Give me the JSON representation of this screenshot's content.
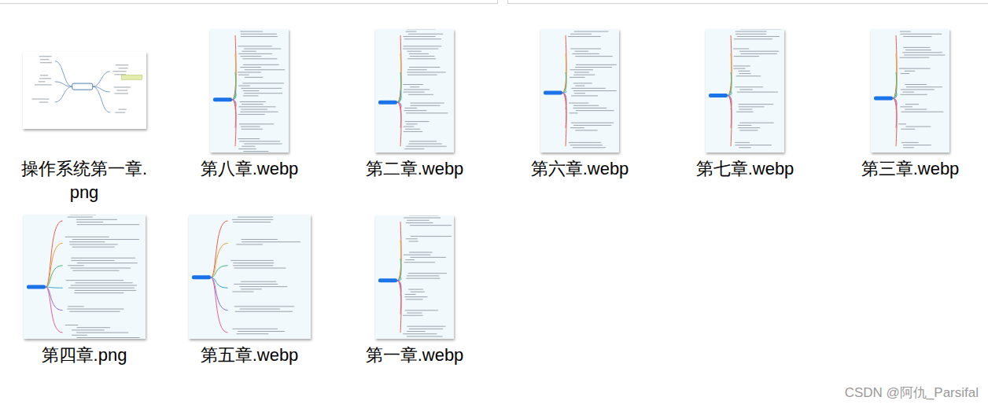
{
  "files": [
    {
      "name": "操作系统第一章.png",
      "kind": "landscape"
    },
    {
      "name": "第八章.webp",
      "kind": "portrait"
    },
    {
      "name": "第二章.webp",
      "kind": "portrait"
    },
    {
      "name": "第六章.webp",
      "kind": "portrait"
    },
    {
      "name": "第七章.webp",
      "kind": "portrait"
    },
    {
      "name": "第三章.webp",
      "kind": "portrait"
    },
    {
      "name": "第四章.png",
      "kind": "square"
    },
    {
      "name": "第五章.webp",
      "kind": "square"
    },
    {
      "name": "第一章.webp",
      "kind": "portrait"
    }
  ],
  "watermark": "CSDN @阿仇_Parsifal"
}
